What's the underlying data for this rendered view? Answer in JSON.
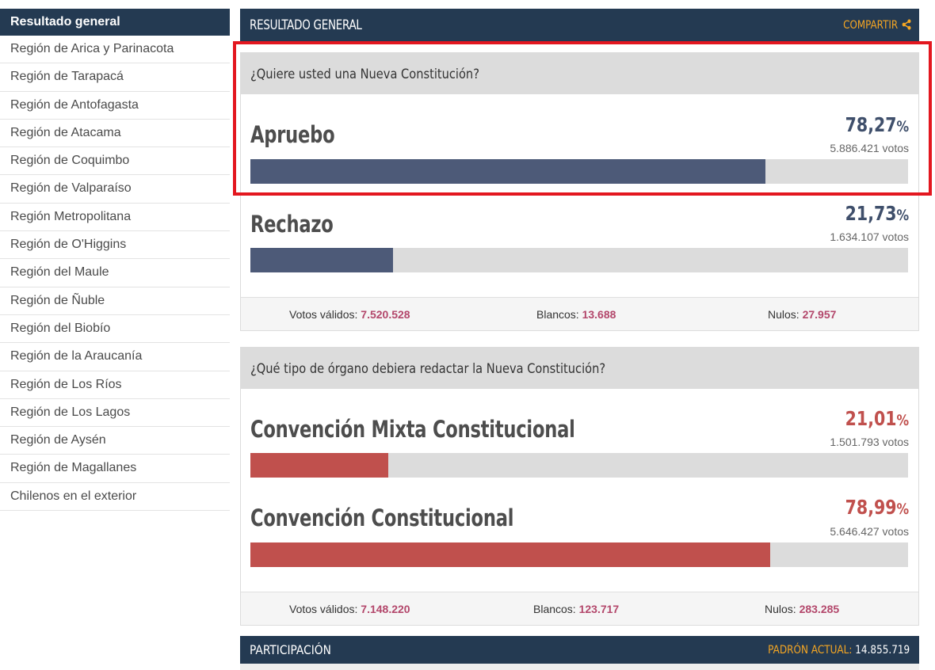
{
  "sidebar": {
    "items": [
      {
        "label": "Resultado general",
        "active": true
      },
      {
        "label": "Región de Arica y Parinacota"
      },
      {
        "label": "Región de Tarapacá"
      },
      {
        "label": "Región de Antofagasta"
      },
      {
        "label": "Región de Atacama"
      },
      {
        "label": "Región de Coquimbo"
      },
      {
        "label": "Región de Valparaíso"
      },
      {
        "label": "Región Metropolitana"
      },
      {
        "label": "Región de O'Higgins"
      },
      {
        "label": "Región del Maule"
      },
      {
        "label": "Región de Ñuble"
      },
      {
        "label": "Región del Biobío"
      },
      {
        "label": "Región de la Araucanía"
      },
      {
        "label": "Región de Los Ríos"
      },
      {
        "label": "Región de Los Lagos"
      },
      {
        "label": "Región de Aysén"
      },
      {
        "label": "Región de Magallanes"
      },
      {
        "label": "Chilenos en el exterior"
      }
    ]
  },
  "header": {
    "title": "RESULTADO GENERAL",
    "share_label": "COMPARTIR",
    "share_icon": "share-icon"
  },
  "colors": {
    "navy": "#243a52",
    "accent": "#f5a623",
    "bar_blue": "#4d5a78",
    "bar_red": "#c0504d",
    "value_pink": "#b3476b",
    "highlight": "#e3171f"
  },
  "q1": {
    "question": "¿Quiere usted una Nueva Constitución?",
    "options": [
      {
        "label": "Apruebo",
        "pct": "78,27",
        "pct_sign": "%",
        "votes": "5.886.421 votos",
        "share": 0.7827
      },
      {
        "label": "Rechazo",
        "pct": "21,73",
        "pct_sign": "%",
        "votes": "1.634.107 votos",
        "share": 0.2173
      }
    ],
    "totals": {
      "valid_label": "Votos válidos:",
      "valid": "7.520.528",
      "blank_label": "Blancos:",
      "blank": "13.688",
      "null_label": "Nulos:",
      "null": "27.957"
    }
  },
  "q2": {
    "question": "¿Qué tipo de órgano debiera redactar la Nueva Constitución?",
    "options": [
      {
        "label": "Convención Mixta Constitucional",
        "pct": "21,01",
        "pct_sign": "%",
        "votes": "1.501.793 votos",
        "share": 0.2101
      },
      {
        "label": "Convención Constitucional",
        "pct": "78,99",
        "pct_sign": "%",
        "votes": "5.646.427 votos",
        "share": 0.7899
      }
    ],
    "totals": {
      "valid_label": "Votos válidos:",
      "valid": "7.148.220",
      "blank_label": "Blancos:",
      "blank": "123.717",
      "null_label": "Nulos:",
      "null": "283.285"
    }
  },
  "participation": {
    "title": "PARTICIPACIÓN",
    "padron_label": "PADRÓN ACTUAL:",
    "padron_value": "14.855.719"
  }
}
